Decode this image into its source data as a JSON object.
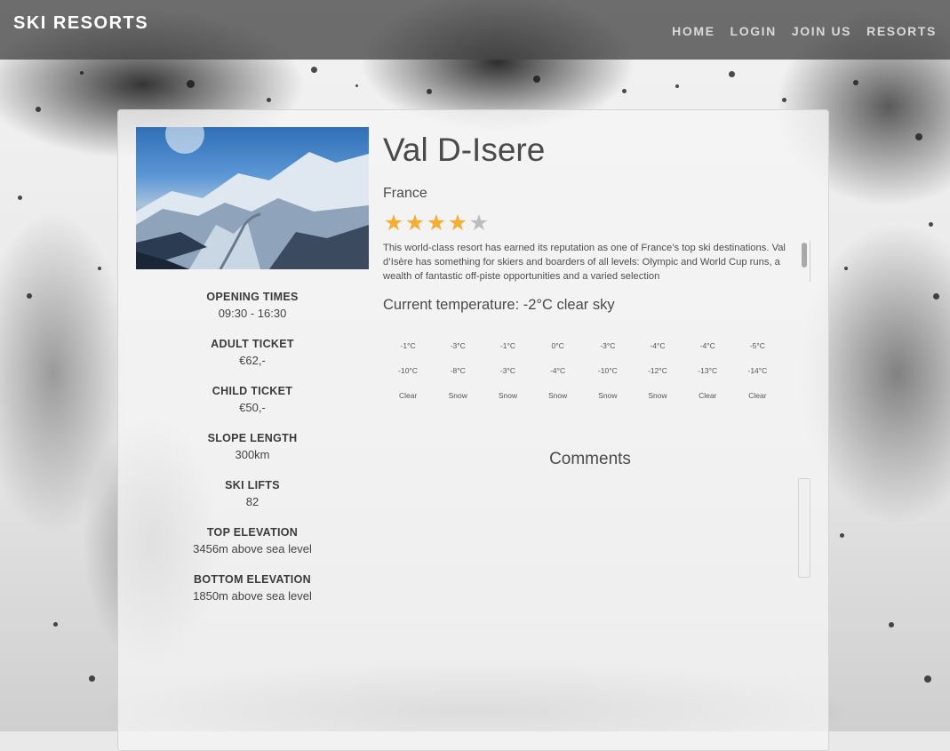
{
  "navbar": {
    "brand": "SKI RESORTS",
    "links": [
      "HOME",
      "LOGIN",
      "JOIN US",
      "RESORTS"
    ]
  },
  "resort": {
    "name": "Val D-Isere",
    "country": "France",
    "rating": 4,
    "rating_max": 5,
    "description": "This world-class resort has earned its reputation as one of France’s top ski destinations. Val d’Isère has something for skiers and boarders of all levels: Olympic and World Cup runs, a wealth of fantastic off-piste opportunities and a varied selection",
    "current_temperature": "Current temperature: -2°C clear sky",
    "image_icon": "mountain-landscape-photo"
  },
  "facts": [
    {
      "label": "OPENING TIMES",
      "value": "09:30 - 16:30"
    },
    {
      "label": "ADULT TICKET",
      "value": "€62,-"
    },
    {
      "label": "CHILD TICKET",
      "value": "€50,-"
    },
    {
      "label": "SLOPE LENGTH",
      "value": "300km"
    },
    {
      "label": "SKI LIFTS",
      "value": "82"
    },
    {
      "label": "TOP ELEVATION",
      "value": "3456m above sea level"
    },
    {
      "label": "BOTTOM ELEVATION",
      "value": "1850m above sea level"
    }
  ],
  "forecast": {
    "highs": [
      "-1°C",
      "-3°C",
      "-1°C",
      "0°C",
      "-3°C",
      "-4°C",
      "-4°C",
      "-5°C"
    ],
    "lows": [
      "-10°C",
      "-8°C",
      "-3°C",
      "-4°C",
      "-10°C",
      "-12°C",
      "-13°C",
      "-14°C"
    ],
    "conditions": [
      "Clear",
      "Snow",
      "Snow",
      "Snow",
      "Snow",
      "Snow",
      "Clear",
      "Clear"
    ]
  },
  "comments": {
    "title": "Comments"
  },
  "colors": {
    "star_on": "#f5ad34",
    "star_off": "#bdbdbd",
    "navbar": "#464646"
  }
}
